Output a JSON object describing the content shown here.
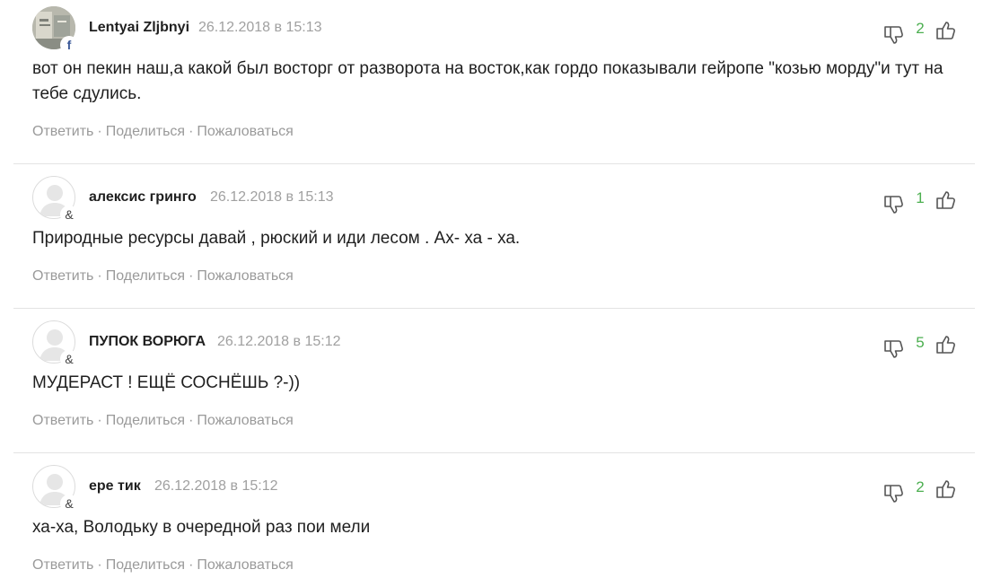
{
  "comments": [
    {
      "author": "Lentyai Zljbnyi",
      "date": "26.12.2018 в 15:13",
      "text": "вот он пекин наш,а какой был восторг от разворота на восток,как гордо показывали гейропе \"козью морду\"и тут на тебе сдулись.",
      "votes": "2",
      "badge": "f",
      "avatar_type": "photo"
    },
    {
      "author": "алексис гринго",
      "date": "26.12.2018 в 15:13",
      "text": "Природные ресурсы давай , рюский и иди лесом . Ах- ха - ха.",
      "votes": "1",
      "badge": "&",
      "avatar_type": "default"
    },
    {
      "author": "ПУПОК ВОРЮГА",
      "date": "26.12.2018 в 15:12",
      "text": "МУДЕРАСТ ! ЕЩЁ СОСНЁШЬ ?-))",
      "votes": "5",
      "badge": "&",
      "avatar_type": "default"
    },
    {
      "author": "ере тик",
      "date": "26.12.2018 в 15:12",
      "text": "ха-ха, Володьку в очередной раз пои мели",
      "votes": "2",
      "badge": "&",
      "avatar_type": "default"
    }
  ],
  "actions": {
    "reply": "Ответить",
    "share": "Поделиться",
    "report": "Пожаловаться",
    "separator": "·"
  },
  "colors": {
    "vote_count": "#4caf50",
    "meta_gray": "#a0a0a0",
    "text": "#1f1f1f"
  }
}
